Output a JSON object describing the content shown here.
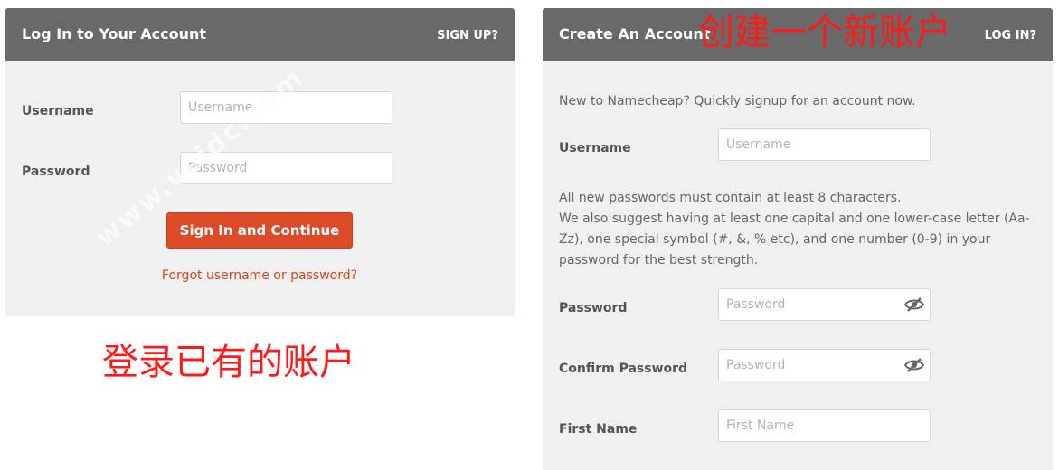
{
  "login_panel": {
    "title": "Log In to Your Account",
    "header_link": "SIGN UP?",
    "username_label": "Username",
    "username_placeholder": "Username",
    "password_label": "Password",
    "password_placeholder": "Password",
    "submit_label": "Sign In and Continue",
    "forgot_link": "Forgot username or password?"
  },
  "signup_panel": {
    "title": "Create An Account",
    "header_link": "LOG IN?",
    "intro": "New to Namecheap? Quickly signup for an account now.",
    "username_label": "Username",
    "username_placeholder": "Username",
    "password_note_1": "All new passwords must contain at least 8 characters.",
    "password_note_2": "We also suggest having at least one capital and one lower-case letter (Aa-Zz), one special symbol (#, &, % etc), and one number (0-9) in your password for the best strength.",
    "password_label": "Password",
    "password_placeholder": "Password",
    "confirm_label": "Confirm Password",
    "confirm_placeholder": "Password",
    "first_name_label": "First Name",
    "first_name_placeholder": "First Name"
  },
  "annotations": {
    "create_account_cn": "创建一个新账户",
    "login_existing_cn": "登录已有的账户",
    "watermark": "www.veidc.com"
  },
  "colors": {
    "header_bg": "#696969",
    "panel_bg": "#f0f0f0",
    "accent": "#dd4a27",
    "annotation_red": "#ff1a1a"
  },
  "icons": {
    "password_toggle": "eye-slash-icon"
  }
}
